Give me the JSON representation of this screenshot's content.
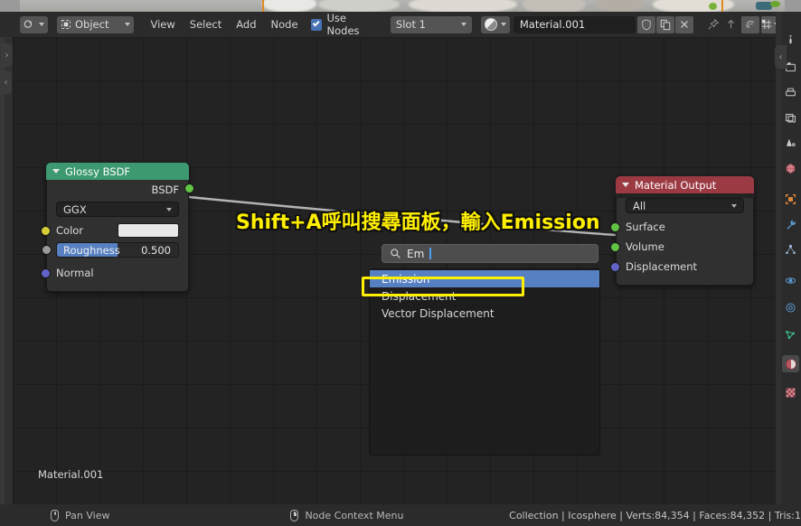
{
  "header": {
    "editor_type_icon": "node-editor-icon",
    "mode_icon": "object-mode-icon",
    "mode_label": "Object",
    "menus": [
      "View",
      "Select",
      "Add",
      "Node"
    ],
    "use_nodes_label": "Use Nodes",
    "use_nodes_checked": true,
    "slot_label": "Slot 1",
    "material_browse_icon": "material-sphere-icon",
    "material_name": "Material.001",
    "shield_icon": "shield-icon",
    "copy_icon": "duplicate-icon",
    "close_icon": "close-x-icon",
    "pin_icon": "pin-icon",
    "up_icon": "arrow-up-icon",
    "snap_icon": "snap-magnet-icon",
    "snap_target_icon": "snap-target-icon"
  },
  "editor": {
    "corner_material_label": "Material.001",
    "annotation": "Shift+A呼叫搜尋面板，輸入Emission"
  },
  "nodes": [
    {
      "name": "glossy-bsdf",
      "title": "Glossy BSDF",
      "header_color": "#3d9970",
      "outputs": [
        {
          "label": "BSDF",
          "socket_color": "#62c445"
        }
      ],
      "distribution": "GGX",
      "properties": [
        {
          "label": "Color",
          "type": "color",
          "value": "#e8e8e8",
          "socket_color": "#d8cf38"
        },
        {
          "label": "Roughness",
          "type": "slider",
          "value": "0.500",
          "fill_pct": 50,
          "socket_color": "#9a9a9a"
        },
        {
          "label": "Normal",
          "type": "input",
          "socket_color": "#6363c7"
        }
      ]
    },
    {
      "name": "material-output",
      "title": "Material Output",
      "header_color": "#9c3a44",
      "target": "All",
      "inputs": [
        {
          "label": "Surface",
          "socket_color": "#62c445"
        },
        {
          "label": "Volume",
          "socket_color": "#62c445"
        },
        {
          "label": "Displacement",
          "socket_color": "#6363c7"
        }
      ]
    }
  ],
  "search_popup": {
    "search_icon": "magnifier-icon",
    "query": "Em",
    "results": [
      {
        "label": "Emission",
        "selected": true
      },
      {
        "label": "Displacement",
        "selected": false
      },
      {
        "label": "Vector Displacement",
        "selected": false
      }
    ]
  },
  "properties_tabs": [
    {
      "name": "tool-tab",
      "icon": "screwdriver-wrench-icon",
      "color": "#cfcfcf",
      "active": false
    },
    {
      "name": "render-tab",
      "icon": "camera-back-icon",
      "color": "#cfcfcf",
      "active": false
    },
    {
      "name": "output-tab",
      "icon": "printer-icon",
      "color": "#cfcfcf",
      "active": false
    },
    {
      "name": "view-layer-tab",
      "icon": "images-icon",
      "color": "#cfcfcf",
      "active": false
    },
    {
      "name": "scene-tab",
      "icon": "cone-sphere-icon",
      "color": "#cfcfcf",
      "active": false
    },
    {
      "name": "world-tab",
      "icon": "world-globe-icon",
      "color": "#d4717a",
      "active": false
    },
    {
      "name": "object-tab",
      "icon": "orange-square-icon",
      "color": "#e08a3c",
      "active": false
    },
    {
      "name": "modifier-tab",
      "icon": "wrench-icon",
      "color": "#5b9bd5",
      "active": false
    },
    {
      "name": "particles-tab",
      "icon": "particles-icon",
      "color": "#9bb7d4",
      "active": false
    },
    {
      "name": "physics-tab",
      "icon": "physics-orbit-icon",
      "color": "#5b9bd5",
      "active": false
    },
    {
      "name": "constraints-tab",
      "icon": "constraint-icon",
      "color": "#5b9bd5",
      "active": false
    },
    {
      "name": "object-data-tab",
      "icon": "green-triangle-data-icon",
      "color": "#3ec48a",
      "active": false
    },
    {
      "name": "material-tab",
      "icon": "material-sphere-icon",
      "color": "#d4717a",
      "active": true
    },
    {
      "name": "texture-tab",
      "icon": "checker-texture-icon",
      "color": "#d4717a",
      "active": false
    }
  ],
  "status_bar": {
    "left_mouse_icon": "mouse-left-icon",
    "left_label": "Pan View",
    "right_mouse_icon": "mouse-right-icon",
    "right_label": "Node Context Menu",
    "stats": "Collection | Icosphere | Verts:84,354 | Faces:84,352 | Tris:1"
  }
}
